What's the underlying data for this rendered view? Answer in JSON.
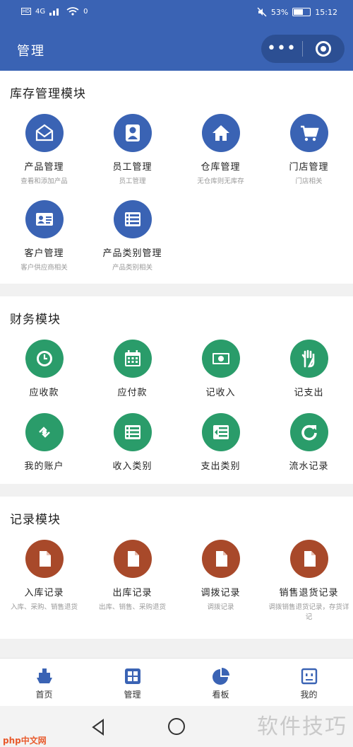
{
  "status_bar": {
    "left_badges": [
      "HD",
      "4G",
      "",
      "0",
      "",
      ""
    ],
    "battery_text": "53%",
    "time": "15:12"
  },
  "navbar": {
    "title": "管理",
    "more_label": "•••"
  },
  "sections": [
    {
      "title": "库存管理模块",
      "color": "#3a63b4",
      "items": [
        {
          "label": "产品管理",
          "desc": "查看和添加产品",
          "icon": "envelope-icon"
        },
        {
          "label": "员工管理",
          "desc": "员工管理",
          "icon": "person-icon"
        },
        {
          "label": "仓库管理",
          "desc": "无仓库则无库存",
          "icon": "house-icon"
        },
        {
          "label": "门店管理",
          "desc": "门店相关",
          "icon": "cart-icon"
        },
        {
          "label": "客户管理",
          "desc": "客户供应商相关",
          "icon": "id-card-icon"
        },
        {
          "label": "产品类别管理",
          "desc": "产品类别相关",
          "icon": "list-icon"
        }
      ]
    },
    {
      "title": "财务模块",
      "color": "#2a9c6a",
      "items": [
        {
          "label": "应收款",
          "desc": "",
          "icon": "clock-icon"
        },
        {
          "label": "应付款",
          "desc": "",
          "icon": "calendar-icon"
        },
        {
          "label": "记收入",
          "desc": "",
          "icon": "money-icon"
        },
        {
          "label": "记支出",
          "desc": "",
          "icon": "hand-icon"
        },
        {
          "label": "我的账户",
          "desc": "",
          "icon": "transfer-icon"
        },
        {
          "label": "收入类别",
          "desc": "",
          "icon": "list-icon"
        },
        {
          "label": "支出类别",
          "desc": "",
          "icon": "outdent-icon"
        },
        {
          "label": "流水记录",
          "desc": "",
          "icon": "refresh-icon"
        }
      ]
    },
    {
      "title": "记录模块",
      "color": "#a8492a",
      "items": [
        {
          "label": "入库记录",
          "desc": "入库、采购、销售退货",
          "icon": "document-icon"
        },
        {
          "label": "出库记录",
          "desc": "出库、销售、采购退货",
          "icon": "document-icon"
        },
        {
          "label": "调拨记录",
          "desc": "调拨记录",
          "icon": "document-icon"
        },
        {
          "label": "销售退货记录",
          "desc": "调拨销售退货记录，存货详记",
          "icon": "document-icon"
        }
      ]
    }
  ],
  "tabbar": [
    {
      "label": "首页",
      "icon": "ship-icon",
      "color": "#3a63b4"
    },
    {
      "label": "管理",
      "icon": "grid-icon",
      "color": "#3a63b4"
    },
    {
      "label": "看板",
      "icon": "pie-chart-icon",
      "color": "#3a63b4"
    },
    {
      "label": "我的",
      "icon": "robot-icon",
      "color": "#3a63b4"
    }
  ],
  "watermark_left": "php中文网",
  "watermark_right": "软件技巧"
}
